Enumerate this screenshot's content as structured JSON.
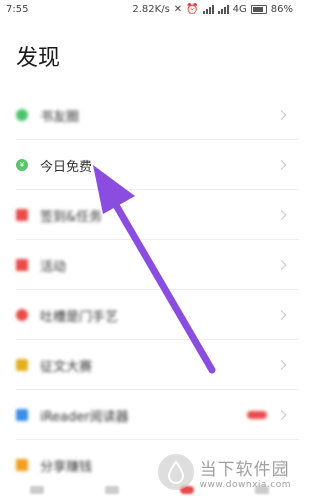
{
  "status_bar": {
    "time": "7:55",
    "speed": "2.82K/s",
    "network": "4G",
    "battery": "86%"
  },
  "page": {
    "title": "发现"
  },
  "items": [
    {
      "label": "书友圈",
      "icon": "green-dot-icon",
      "color": "#4cc36b",
      "blurred": true
    },
    {
      "label": "今日免费",
      "icon": "yen-icon",
      "color": "#5cc46a",
      "blurred": false
    },
    {
      "label": "签到&任务",
      "icon": "calendar-icon",
      "color": "#e94b4b",
      "blurred": true
    },
    {
      "label": "活动",
      "icon": "flag-icon",
      "color": "#e94b4b",
      "blurred": true
    },
    {
      "label": "吐槽是门手艺",
      "icon": "pin-icon",
      "color": "#e94b4b",
      "blurred": true
    },
    {
      "label": "征文大赛",
      "icon": "trophy-icon",
      "color": "#e3b020",
      "blurred": true
    },
    {
      "label": "iReader阅读器",
      "icon": "ereader-icon",
      "color": "#3a8ee6",
      "blurred": true,
      "badge": true
    },
    {
      "label": "分享赚钱",
      "icon": "warning-icon",
      "color": "#f0a020",
      "blurred": true
    }
  ],
  "watermark": {
    "title": "当下软件园",
    "url": "www.downxia.com"
  },
  "colors": {
    "arrow": "#8a4de0"
  }
}
